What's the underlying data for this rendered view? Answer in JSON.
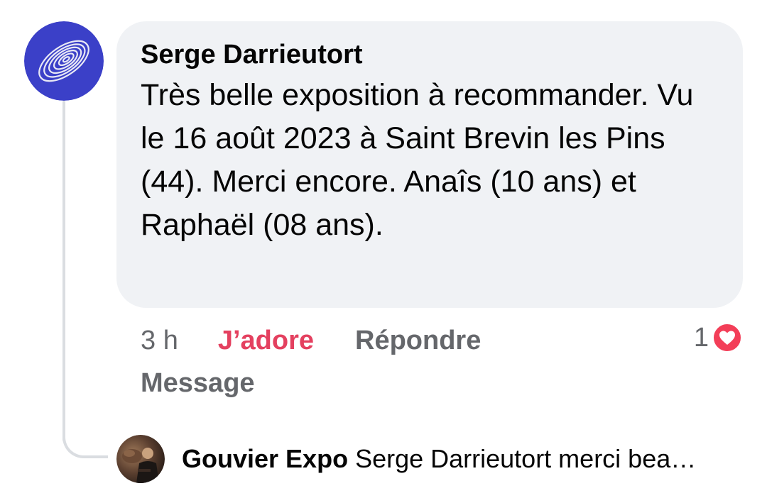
{
  "comment": {
    "author": "Serge Darrieutort",
    "text": "Très belle exposition à recommander. Vu le 16 août 2023 à Saint Brevin les Pins (44). Merci encore. Anaîs (10 ans) et Raphaël (08 ans).",
    "avatar_icon": "spiral-avatar-icon"
  },
  "actions": {
    "time": "3 h",
    "like_label": "J’adore",
    "reply_label": "Répondre",
    "message_label": "Message"
  },
  "reactions": {
    "count": "1",
    "icon": "heart-icon",
    "color": "#f33e58"
  },
  "reply": {
    "author": "Gouvier Expo",
    "text": "Serge Darrieutort merci bea…",
    "avatar_icon": "photo-avatar-icon"
  },
  "colors": {
    "bubble": "#f0f2f5",
    "like_active": "#e4405f",
    "secondary_text": "#65676b",
    "avatar_blue": "#3b40c8"
  }
}
